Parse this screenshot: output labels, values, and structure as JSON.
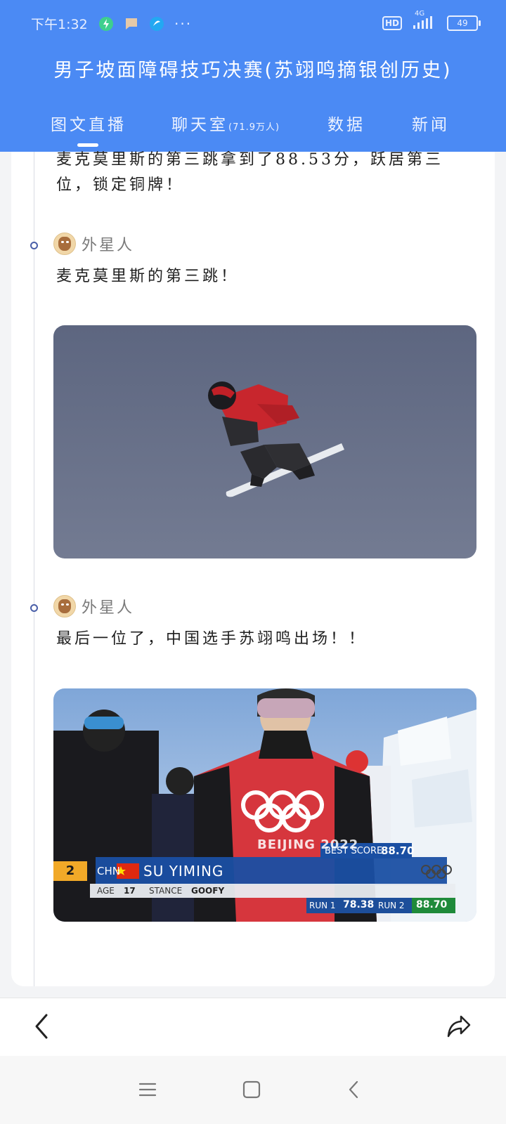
{
  "status": {
    "time": "下午1:32",
    "network": "4G",
    "battery": "49",
    "hd": "HD"
  },
  "header": {
    "title": "男子坡面障碍技巧决赛(苏翊鸣摘银创历史)"
  },
  "tabs": [
    {
      "label": "图文直播",
      "active": true
    },
    {
      "label": "聊天室",
      "sub": "(71.9万人)"
    },
    {
      "label": "数据"
    },
    {
      "label": "新闻"
    }
  ],
  "feed": {
    "top_text": "麦克莫里斯的第三跳拿到了88.53分，跃居第三位，锁定铜牌！",
    "posts": [
      {
        "author": "外星人",
        "text": "麦克莫里斯的第三跳！"
      },
      {
        "author": "外星人",
        "text": "最后一位了，中国选手苏翊鸣出场！！"
      }
    ]
  },
  "broadcast_overlay": {
    "rank": "2",
    "country": "CHN",
    "name": "SU YIMING",
    "best_score_label": "BEST SCORE",
    "best_score": "88.70",
    "age_label": "AGE",
    "age": "17",
    "stance_label": "STANCE",
    "stance": "GOOFY",
    "run1_label": "RUN 1",
    "run1": "78.38",
    "run2_label": "RUN 2",
    "run2": "88.70",
    "bib_text": "BEIJING 2022"
  },
  "icons": {
    "back": "chevron-left-icon",
    "share": "share-icon",
    "menu": "menu-icon",
    "home": "square-home-icon",
    "nav_back": "nav-back-icon"
  },
  "colors": {
    "header": "#4b8af4",
    "card": "#ffffff",
    "timeline_dot": "#4a5fa8"
  }
}
